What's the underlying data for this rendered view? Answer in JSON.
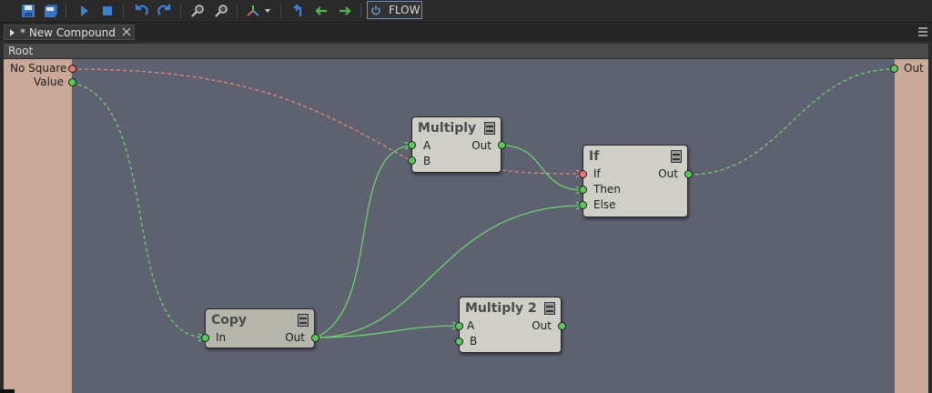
{
  "toolbar": {
    "buttons": [
      {
        "icon": "save-icon"
      },
      {
        "icon": "save-all-icon"
      },
      {
        "icon": "play-icon"
      },
      {
        "icon": "stop-icon"
      },
      {
        "icon": "undo-icon"
      },
      {
        "icon": "redo-icon"
      },
      {
        "icon": "zoom-in-icon"
      },
      {
        "icon": "zoom-out-icon"
      },
      {
        "icon": "axis-dropdown-icon"
      },
      {
        "icon": "go-up-icon"
      },
      {
        "icon": "back-icon"
      },
      {
        "icon": "forward-icon"
      }
    ],
    "flow_label": "FLOW"
  },
  "tabs": [
    {
      "label": "* New Compound"
    }
  ],
  "breadcrumb": "Root",
  "inputs": {
    "no_square": "No Square",
    "value": "Value"
  },
  "outputs": {
    "out": "Out"
  },
  "nodes": {
    "multiply": {
      "title": "Multiply",
      "in_a": "A",
      "in_b": "B",
      "out": "Out"
    },
    "if": {
      "title": "If",
      "in_if": "If",
      "in_then": "Then",
      "in_else": "Else",
      "out": "Out"
    },
    "copy": {
      "title": "Copy",
      "in": "In",
      "out": "Out"
    },
    "multiply2": {
      "title": "Multiply 2",
      "in_a": "A",
      "in_b": "B",
      "out": "Out"
    }
  },
  "colors": {
    "canvas": "#5d6170",
    "panel": "#c9a898",
    "node": "#cfcfc7",
    "wire_green": "#6fd06f",
    "wire_red": "#e8857c",
    "accent": "#6b8fb5"
  }
}
